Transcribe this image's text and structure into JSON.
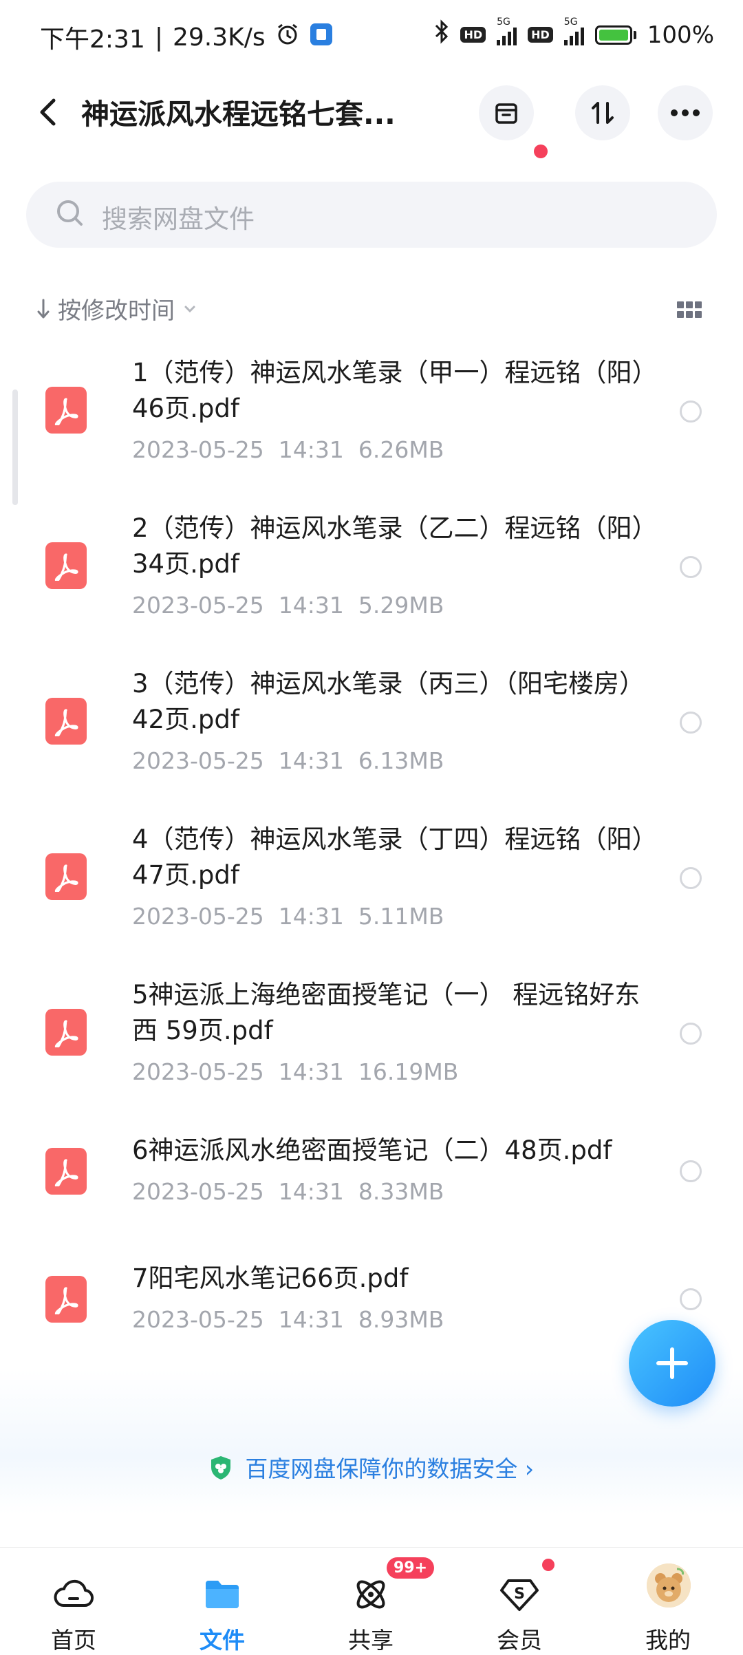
{
  "status": {
    "time": "下午2:31",
    "speed": "29.3K/s",
    "hd1": "HD",
    "hd2": "HD",
    "net1": "5G",
    "net2": "5G",
    "battery": "100%"
  },
  "header": {
    "title": "神运派风水程远铭七套..."
  },
  "search": {
    "placeholder": "搜索网盘文件"
  },
  "sort": {
    "label": "按修改时间"
  },
  "files": [
    {
      "name": "1（范传）神运风水笔录（甲一）程远铭（阳）46页.pdf",
      "date": "2023-05-25",
      "time": "14:31",
      "size": "6.26MB"
    },
    {
      "name": "2（范传）神运风水笔录（乙二）程远铭（阳）34页.pdf",
      "date": "2023-05-25",
      "time": "14:31",
      "size": "5.29MB"
    },
    {
      "name": "3（范传）神运风水笔录（丙三）（阳宅楼房）42页.pdf",
      "date": "2023-05-25",
      "time": "14:31",
      "size": "6.13MB"
    },
    {
      "name": "4（范传）神运风水笔录（丁四）程远铭（阳）47页.pdf",
      "date": "2023-05-25",
      "time": "14:31",
      "size": "5.11MB"
    },
    {
      "name": "5神运派上海绝密面授笔记（一） 程远铭好东西 59页.pdf",
      "date": "2023-05-25",
      "time": "14:31",
      "size": "16.19MB"
    },
    {
      "name": "6神运派风水绝密面授笔记（二）48页.pdf",
      "date": "2023-05-25",
      "time": "14:31",
      "size": "8.33MB"
    },
    {
      "name": "7阳宅风水笔记66页.pdf",
      "date": "2023-05-25",
      "time": "14:31",
      "size": "8.93MB"
    }
  ],
  "safety": {
    "text": "百度网盘保障你的数据安全 ›"
  },
  "nav": {
    "home": "首页",
    "files": "文件",
    "share": "共享",
    "member": "会员",
    "mine": "我的",
    "share_badge": "99+"
  },
  "colors": {
    "accent": "#1e8cf7",
    "pdf": "#f96868",
    "badge": "#f5405b"
  }
}
